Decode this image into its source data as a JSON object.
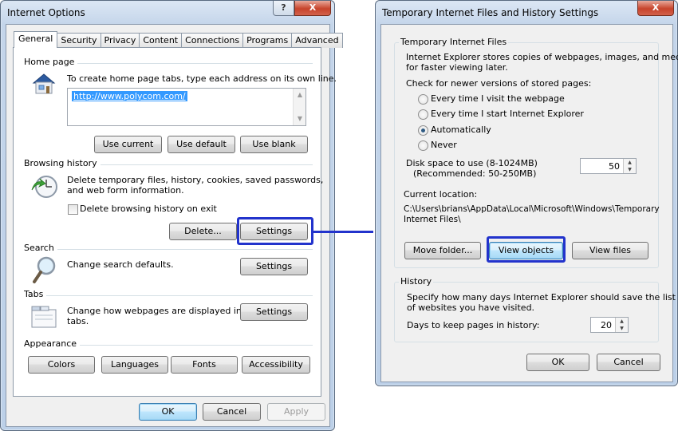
{
  "internet_options": {
    "title": "Internet Options",
    "title_buttons": {
      "help": "?",
      "close": "X"
    },
    "tabs": [
      "General",
      "Security",
      "Privacy",
      "Content",
      "Connections",
      "Programs",
      "Advanced"
    ],
    "home_page": {
      "heading": "Home page",
      "description": "To create home page tabs, type each address on its own line.",
      "url": "http://www.polycom.com/",
      "buttons": [
        "Use current",
        "Use default",
        "Use blank"
      ]
    },
    "browsing_history": {
      "heading": "Browsing history",
      "description_line1": "Delete temporary files, history, cookies, saved passwords,",
      "description_line2": "and web form information.",
      "checkbox_label": "Delete browsing history on exit",
      "delete_button": "Delete...",
      "settings_button": "Settings"
    },
    "search": {
      "heading": "Search",
      "description": "Change search defaults.",
      "settings_button": "Settings"
    },
    "tabs_section": {
      "heading": "Tabs",
      "description_line1": "Change how webpages are displayed in",
      "description_line2": "tabs.",
      "settings_button": "Settings"
    },
    "appearance": {
      "heading": "Appearance",
      "buttons": [
        "Colors",
        "Languages",
        "Fonts",
        "Accessibility"
      ]
    },
    "footer": {
      "ok": "OK",
      "cancel": "Cancel",
      "apply": "Apply"
    }
  },
  "temp_files_settings": {
    "title": "Temporary Internet Files and History Settings",
    "title_buttons": {
      "close": "X"
    },
    "temp_files": {
      "heading": "Temporary Internet Files",
      "description_line1": "Internet Explorer stores copies of webpages, images, and media",
      "description_line2": "for faster viewing later.",
      "check_label": "Check for newer versions of stored pages:",
      "radio_options": [
        "Every time I visit the webpage",
        "Every time I start Internet Explorer",
        "Automatically",
        "Never"
      ],
      "selected_option": "Automatically",
      "disk_label_line1": "Disk space to use (8-1024MB)",
      "disk_label_line2": "(Recommended: 50-250MB)",
      "disk_value": "50",
      "location_label": "Current location:",
      "location_line1": "C:\\Users\\brians\\AppData\\Local\\Microsoft\\Windows\\Temporary",
      "location_line2": "Internet Files\\",
      "buttons": [
        "Move folder...",
        "View objects",
        "View files"
      ]
    },
    "history": {
      "heading": "History",
      "description_line1": "Specify how many days Internet Explorer should save the list",
      "description_line2": "of websites you have visited.",
      "days_label": "Days to keep pages in history:",
      "days_value": "20"
    },
    "footer": {
      "ok": "OK",
      "cancel": "Cancel"
    }
  },
  "annotation": {
    "highlight_color": "#2233cc"
  }
}
